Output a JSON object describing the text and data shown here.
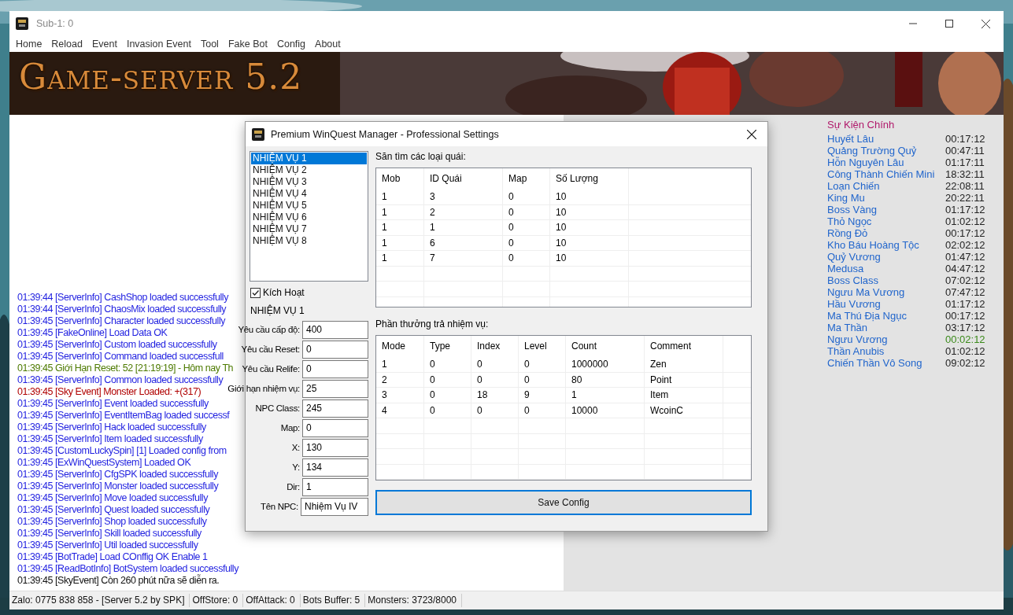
{
  "window": {
    "title": "Sub-1: 0"
  },
  "menu": [
    "Home",
    "Reload",
    "Event",
    "Invasion Event",
    "Tool",
    "Fake Bot",
    "Config",
    "About"
  ],
  "banner": {
    "title": "Game-server 5.2"
  },
  "log": [
    {
      "text": "01:39:44 [ServerInfo] CashShop loaded successfully",
      "color": "#1f1fe0"
    },
    {
      "text": "01:39:44 [ServerInfo] ChaosMix loaded successfully",
      "color": "#1f1fe0"
    },
    {
      "text": "01:39:45 [ServerInfo] Character loaded successfully",
      "color": "#1f1fe0"
    },
    {
      "text": "01:39:45 [FakeOnline] Load Data OK",
      "color": "#1f1fe0"
    },
    {
      "text": "01:39:45 [ServerInfo] Custom loaded successfully",
      "color": "#1f1fe0"
    },
    {
      "text": "01:39:45 [ServerInfo] Command loaded successfull",
      "color": "#1f1fe0"
    },
    {
      "text": "01:39:45 Giới Hạn Reset: 52 [21:19:19] - Hôm nay Th",
      "color": "#4d7a00"
    },
    {
      "text": "01:39:45 [ServerInfo] Common loaded successfully",
      "color": "#1f1fe0"
    },
    {
      "text": "01:39:45 [Sky Event] Monster Loaded: +(317)",
      "color": "#b00000"
    },
    {
      "text": "01:39:45 [ServerInfo] Event loaded successfully",
      "color": "#1f1fe0"
    },
    {
      "text": "01:39:45 [ServerInfo] EventItemBag loaded successf",
      "color": "#1f1fe0"
    },
    {
      "text": "01:39:45 [ServerInfo] Hack loaded successfully",
      "color": "#1f1fe0"
    },
    {
      "text": "01:39:45 [ServerInfo] Item loaded successfully",
      "color": "#1f1fe0"
    },
    {
      "text": "01:39:45 [CustomLuckySpin] [1] Loaded config from",
      "color": "#1f1fe0"
    },
    {
      "text": "01:39:45 [ExWinQuestSystem] Loaded OK",
      "color": "#1f1fe0"
    },
    {
      "text": "01:39:45 [ServerInfo] CfgSPK loaded successfully",
      "color": "#1f1fe0"
    },
    {
      "text": "01:39:45 [ServerInfo] Monster loaded successfully",
      "color": "#1f1fe0"
    },
    {
      "text": "01:39:45 [ServerInfo] Move loaded successfully",
      "color": "#1f1fe0"
    },
    {
      "text": "01:39:45 [ServerInfo] Quest loaded successfully",
      "color": "#1f1fe0"
    },
    {
      "text": "01:39:45 [ServerInfo] Shop loaded successfully",
      "color": "#1f1fe0"
    },
    {
      "text": "01:39:45 [ServerInfo] Skill loaded successfully",
      "color": "#1f1fe0"
    },
    {
      "text": "01:39:45 [ServerInfo] Util loaded successfully",
      "color": "#1f1fe0"
    },
    {
      "text": "01:39:45 [BotTrade] Load COnffig OK Enable 1",
      "color": "#1f1fe0"
    },
    {
      "text": "01:39:45 [ReadBotInfo] BotSystem loaded successfully",
      "color": "#1f1fe0"
    },
    {
      "text": "01:39:45 [SkyEvent] Còn 260 phút nữa sẽ diễn ra.",
      "color": "#111111"
    }
  ],
  "events": {
    "title": "Sự Kiện Chính",
    "items": [
      {
        "name": "Huyết Lâu",
        "time": "00:17:12",
        "color": "#222222"
      },
      {
        "name": "Quảng Trường Quỷ",
        "time": "00:47:11",
        "color": "#222222"
      },
      {
        "name": "Hỗn Nguyên Lâu",
        "time": "01:17:11",
        "color": "#222222"
      },
      {
        "name": "Công Thành Chiến Mini",
        "time": "18:32:11",
        "color": "#222222"
      },
      {
        "name": "Loạn Chiến",
        "time": "22:08:11",
        "color": "#222222"
      },
      {
        "name": "King Mu",
        "time": "20:22:11",
        "color": "#222222"
      },
      {
        "name": "Boss Vàng",
        "time": "01:17:12",
        "color": "#222222"
      },
      {
        "name": "Thỏ Ngọc",
        "time": "01:02:12",
        "color": "#222222"
      },
      {
        "name": "Rồng Đỏ",
        "time": "00:17:12",
        "color": "#222222"
      },
      {
        "name": "Kho Báu Hoàng Tộc",
        "time": "02:02:12",
        "color": "#222222"
      },
      {
        "name": "Quỷ Vương",
        "time": "01:47:12",
        "color": "#222222"
      },
      {
        "name": "Medusa",
        "time": "04:47:12",
        "color": "#222222"
      },
      {
        "name": "Boss Class",
        "time": "07:02:12",
        "color": "#222222"
      },
      {
        "name": "Ngưu Ma Vương",
        "time": "07:47:12",
        "color": "#222222"
      },
      {
        "name": "Hầu Vương",
        "time": "01:17:12",
        "color": "#222222"
      },
      {
        "name": "Ma Thú Địa Ngục",
        "time": "00:17:12",
        "color": "#222222"
      },
      {
        "name": "Ma Thần",
        "time": "03:17:12",
        "color": "#222222"
      },
      {
        "name": "Ngưu Vương",
        "time": "00:02:12",
        "color": "#3a8a1a"
      },
      {
        "name": "Thần Anubis",
        "time": "01:02:12",
        "color": "#222222"
      },
      {
        "name": "Chiến Thần Vô Song",
        "time": "09:02:12",
        "color": "#222222"
      }
    ]
  },
  "status_bar": [
    "Zalo: 0775 838 858 - [Server 5.2 by SPK]",
    "OffStore: 0",
    "OffAttack: 0",
    "Bots Buffer: 5",
    "Monsters: 3723/8000"
  ],
  "dialog": {
    "title": "Premium WinQuest Manager - Professional Settings",
    "quests": [
      {
        "label": "NHIỆM VỤ 1",
        "selected": true
      },
      {
        "label": "NHIỆM VỤ 2",
        "selected": false
      },
      {
        "label": "NHIỆM VỤ 3",
        "selected": false
      },
      {
        "label": "NHIỆM VỤ 4",
        "selected": false
      },
      {
        "label": "NHIỆM VỤ 5",
        "selected": false
      },
      {
        "label": "NHIỆM VỤ 6",
        "selected": false
      },
      {
        "label": "NHIỆM VỤ 7",
        "selected": false
      },
      {
        "label": "NHIỆM VỤ 8",
        "selected": false
      }
    ],
    "active": {
      "label": "Kích Hoạt",
      "checked": true
    },
    "quest_name": "NHIỆM VỤ 1",
    "fields": [
      {
        "label": "Yêu cầu cấp độ:",
        "value": "400"
      },
      {
        "label": "Yêu cầu Reset:",
        "value": "0"
      },
      {
        "label": "Yêu cầu Relife:",
        "value": "0"
      },
      {
        "label": "Giới hạn nhiệm vụ:",
        "value": "25"
      },
      {
        "label": "NPC Class:",
        "value": "245"
      },
      {
        "label": "Map:",
        "value": "0"
      },
      {
        "label": "X:",
        "value": "130"
      },
      {
        "label": "Y:",
        "value": "134"
      },
      {
        "label": "Dir:",
        "value": "1"
      },
      {
        "label": "Tên NPC:",
        "value": "Nhiệm Vụ IV",
        "kind": "wide"
      }
    ],
    "monsters": {
      "title": "Săn tìm các loại quái:",
      "columns": [
        "Mob",
        "ID Quái",
        "Map",
        "Số Lượng"
      ],
      "rows": [
        [
          "1",
          "3",
          "0",
          "10"
        ],
        [
          "1",
          "2",
          "0",
          "10"
        ],
        [
          "1",
          "1",
          "0",
          "10"
        ],
        [
          "1",
          "6",
          "0",
          "10"
        ],
        [
          "1",
          "7",
          "0",
          "10"
        ]
      ]
    },
    "rewards": {
      "title": "Phần thưởng trả nhiệm vụ:",
      "columns": [
        "Mode",
        "Type",
        "Index",
        "Level",
        "Count",
        "Comment"
      ],
      "rows": [
        [
          "1",
          "0",
          "0",
          "0",
          "1000000",
          "Zen"
        ],
        [
          "2",
          "0",
          "0",
          "0",
          "80",
          "Point"
        ],
        [
          "3",
          "0",
          "18",
          "9",
          "1",
          "Item"
        ],
        [
          "4",
          "0",
          "0",
          "0",
          "10000",
          "WcoinC"
        ]
      ]
    },
    "save_button": "Save Config"
  }
}
